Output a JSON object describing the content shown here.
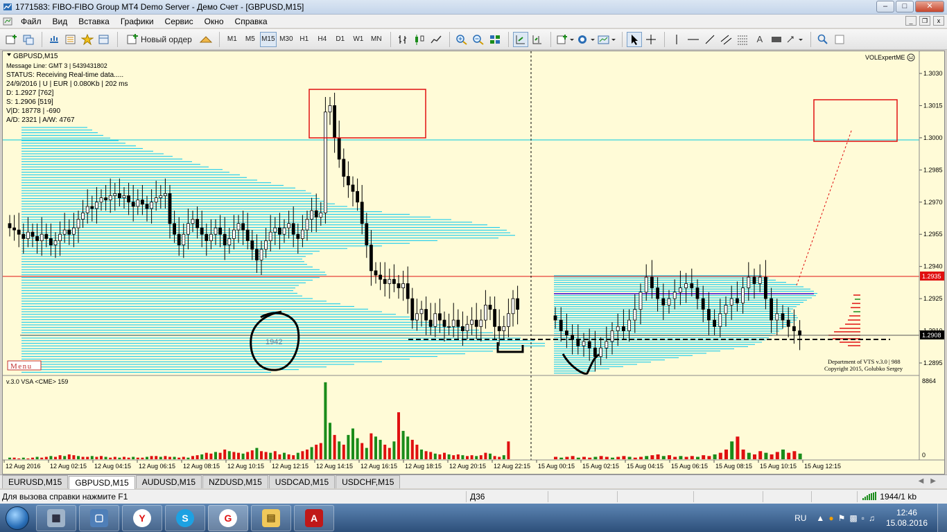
{
  "window": {
    "title": "1771583: FIBO-FIBO Group MT4 Demo Server - Демо Счет - [GBPUSD,M15]"
  },
  "menu": [
    "Файл",
    "Вид",
    "Вставка",
    "Графики",
    "Сервис",
    "Окно",
    "Справка"
  ],
  "toolbar": {
    "new_order_label": "Новый ордер",
    "timeframes": [
      "M1",
      "M5",
      "M15",
      "M30",
      "H1",
      "H4",
      "D1",
      "W1",
      "MN"
    ],
    "active_timeframe": "M15",
    "text_tool": "A"
  },
  "chart": {
    "symbol_header": "GBPUSD,M15",
    "info_lines": [
      "Message Line: GMT 3 | 5439431802",
      "STATUS:  Receiving Real-time data.....",
      "24/9/2016 | U | EUR | 0.080Kb | 202 ms",
      "D: 1.2927  [762]",
      "S: 1.2906  [519]",
      "V|D: 18778 | -690",
      "A/D: 2321  |  A/W: 4767"
    ],
    "expert_label": "VOLExpertME",
    "price_labels": [
      "1.3030",
      "1.3015",
      "1.3000",
      "1.2985",
      "1.2970",
      "1.2955",
      "1.2940",
      "1.2925",
      "1.2910",
      "1.2895"
    ],
    "current_price_red": "1.2935",
    "current_price_black": "1.2908",
    "volume_profile_label": "1942",
    "menu_button": "Menu",
    "copyright_line1": "Department of VTS  v.3.0 | 988",
    "copyright_line2": "Copyright 2015, Golubko Sergey",
    "indicator_label": "v.3.0 VSA <CME> 159",
    "indicator_max": "8864",
    "indicator_min": "0",
    "time_labels": [
      "12 Aug 2016",
      "12 Aug 02:15",
      "12 Aug 04:15",
      "12 Aug 06:15",
      "12 Aug 08:15",
      "12 Aug 10:15",
      "12 Aug 12:15",
      "12 Aug 14:15",
      "12 Aug 16:15",
      "12 Aug 18:15",
      "12 Aug 20:15",
      "12 Aug 22:15",
      "15 Aug 00:15",
      "15 Aug 02:15",
      "15 Aug 04:15",
      "15 Aug 06:15",
      "15 Aug 08:15",
      "15 Aug 10:15",
      "15 Aug 12:15"
    ]
  },
  "tabs": [
    "EURUSD,M15",
    "GBPUSD,M15",
    "AUDUSD,M15",
    "NZDUSD,M15",
    "USDCAD,M15",
    "USDCHF,M15"
  ],
  "active_tab": "GBPUSD,M15",
  "statusbar": {
    "help_text": "Для вызова справки нажмите F1",
    "profile": "Д36",
    "traffic": "1944/1 kb"
  },
  "taskbar": {
    "language": "RU",
    "time": "12:46",
    "date": "15.08.2016"
  },
  "colors": {
    "chart_bg": "#fffbd7",
    "bull": "#ffffff",
    "bear": "#000000",
    "profile": "#00c8f0",
    "vol_up": "#1a8c1a",
    "vol_down": "#e01010",
    "annotation_box": "#e01010"
  }
}
